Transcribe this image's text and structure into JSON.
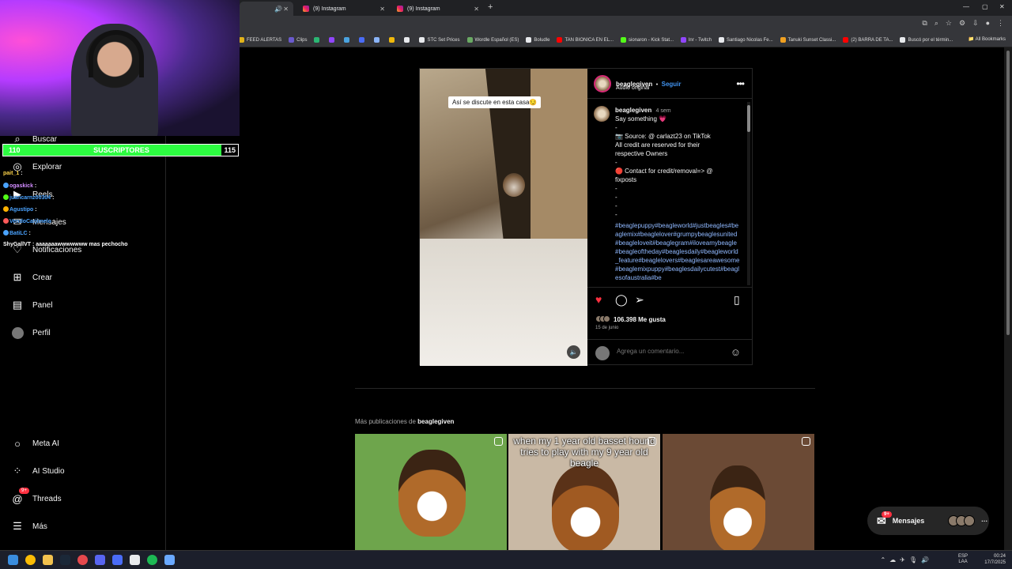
{
  "browser": {
    "tabs": [
      {
        "label": "",
        "active": true
      },
      {
        "label": "(9) Instagram",
        "active": false
      },
      {
        "label": "(9) Instagram",
        "active": false
      }
    ],
    "new_tab_icon": "plus-icon",
    "bookmarks": [
      {
        "label": "FEED ALERTAS",
        "color": "#e0b21a"
      },
      {
        "label": "Clips",
        "color": "#6a5acd"
      },
      {
        "label": "",
        "color": "#2bb673"
      },
      {
        "label": "",
        "color": "#9146ff"
      },
      {
        "label": "",
        "color": "#4aa3df"
      },
      {
        "label": "",
        "color": "#4a6cf7"
      },
      {
        "label": "",
        "color": "#8ab4f8"
      },
      {
        "label": "",
        "color": "#f0b90b"
      },
      {
        "label": "",
        "color": "#e8eaed"
      },
      {
        "label": "STC Set Prices",
        "color": "#e8eaed"
      },
      {
        "label": "Wordle Español (ES)",
        "color": "#6aaa64"
      },
      {
        "label": "Boludle",
        "color": "#e8eaed"
      },
      {
        "label": "TAN BIONICA EN EL...",
        "color": "#ff0000"
      },
      {
        "label": "sionaron - Kick Stat...",
        "color": "#53fc18"
      },
      {
        "label": "lnr - Twitch",
        "color": "#9146ff"
      },
      {
        "label": "Santiago Nicolas Fe...",
        "color": "#e8eaed"
      },
      {
        "label": "Tanuki Sunset Classi...",
        "color": "#f0a020"
      },
      {
        "label": "(2) BARRA DE TA...",
        "color": "#ff0000"
      },
      {
        "label": "Buscó por el términ...",
        "color": "#e8eaed"
      }
    ],
    "all_bookmarks": "All Bookmarks"
  },
  "sidebar": {
    "items": [
      {
        "label": "Buscar",
        "icon": "search-icon"
      },
      {
        "label": "Explorar",
        "icon": "compass-icon"
      },
      {
        "label": "Reels",
        "icon": "reels-icon"
      },
      {
        "label": "Mensajes",
        "icon": "messenger-icon"
      },
      {
        "label": "Notificaciones",
        "icon": "heart-icon"
      },
      {
        "label": "Crear",
        "icon": "plus-square-icon"
      },
      {
        "label": "Panel",
        "icon": "chart-icon"
      },
      {
        "label": "Perfil",
        "icon": "avatar-icon"
      },
      {
        "label": "Meta AI",
        "icon": "meta-ai-icon"
      },
      {
        "label": "AI Studio",
        "icon": "ai-studio-icon"
      },
      {
        "label": "Threads",
        "icon": "threads-icon"
      },
      {
        "label": "Más",
        "icon": "menu-icon"
      }
    ],
    "threads_badge": "9+"
  },
  "post": {
    "overlay_text": "Así se discute en esta casa😏",
    "username": "beaglegiven",
    "follow_label": "Seguir",
    "separator": "•",
    "audio": "Audio original",
    "caption_time": "4 sem",
    "caption_lines": [
      "Say something 💗",
      "-",
      "📷 Source: @ carlazt23 on TikTok",
      "All credit are reserved for their",
      "respective Owners",
      "-",
      "🔴 Contact for credit/removal=> @",
      "fixposts",
      "-",
      "-",
      "-",
      "-"
    ],
    "hashtags": "#beaglepuppy#beagleworld#justbeagles#beaglemix#beaglelover#grumpybeaglesunited#beagleloveit#beaglegram#iloveamybeagle#beagleoftheday#beaglesdaily#beagleworld_feature#beaglelovers#beaglesareawesome#beaglemixpuppy#beaglesdailycutest#beaglesofaustralia#be",
    "likes": "106.398 Me gusta",
    "date": "15 de junio",
    "comment_placeholder": "Agrega un comentario..."
  },
  "more_posts": {
    "prefix": "Más publicaciones de",
    "username": "beaglegiven",
    "thumbs": [
      {
        "text": "",
        "bg": "#6ea54c"
      },
      {
        "text": "when my 1 year old basset hound tries to play with my 9 year old beagle",
        "bg": "#c9b9a5"
      },
      {
        "text": "",
        "bg": "#6b4a35"
      }
    ]
  },
  "messages": {
    "label": "Mensajes",
    "badge": "9+"
  },
  "stream": {
    "sub_left": "110",
    "sub_center": "SUSCRIPTORES",
    "sub_right": "115",
    "chat": [
      {
        "user": "pait_1",
        "msg": ":",
        "color": "#ffd54a"
      },
      {
        "user": "ogaskick",
        "msg": ":",
        "color": "#d28cff"
      },
      {
        "user": "juancarnz00304",
        "msg": ":",
        "color": "#4aa3ff"
      },
      {
        "user": "Agustipo",
        "msg": ":",
        "color": "#4aa3ff"
      },
      {
        "user": "VendoCarjimelo",
        "msg": ":",
        "color": "#4aa3ff"
      },
      {
        "user": "BatiLC",
        "msg": ":",
        "color": "#4aa3ff"
      },
      {
        "user": "ShyGallVT",
        "msg": ": aaaaaaawwwwwww mas pechocho",
        "color": "#ffffff"
      }
    ]
  },
  "taskbar": {
    "lang_top": "ESP",
    "lang_bottom": "LAA",
    "time": "00:24",
    "date": "17/7/2025"
  }
}
